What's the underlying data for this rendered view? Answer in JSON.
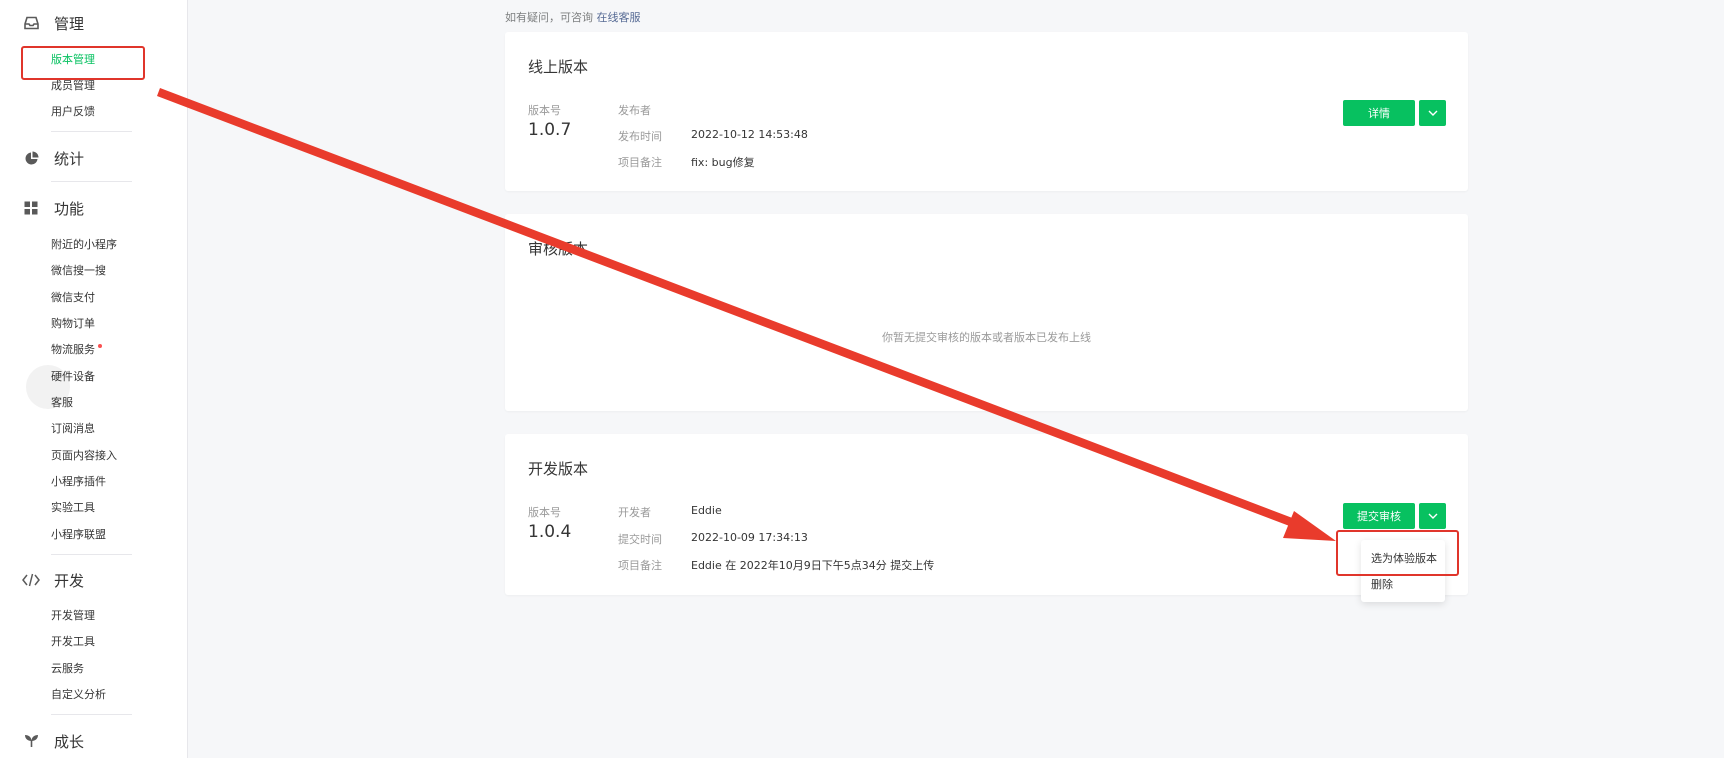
{
  "sidebar": {
    "groups": {
      "manage": {
        "label": "管理",
        "icon": "inbox-icon",
        "items": [
          "版本管理",
          "成员管理",
          "用户反馈"
        ]
      },
      "stats": {
        "label": "统计",
        "icon": "pie-chart-icon"
      },
      "features": {
        "label": "功能",
        "icon": "grid-icon",
        "items": [
          "附近的小程序",
          "微信搜一搜",
          "微信支付",
          "购物订单",
          "物流服务",
          "硬件设备",
          "客服",
          "订阅消息",
          "页面内容接入",
          "小程序插件",
          "实验工具",
          "小程序联盟"
        ]
      },
      "develop": {
        "label": "开发",
        "icon": "code-icon",
        "items": [
          "开发管理",
          "开发工具",
          "云服务",
          "自定义分析"
        ]
      },
      "growth": {
        "label": "成长",
        "icon": "sprout-icon"
      }
    }
  },
  "helper": {
    "text": "如有疑问，可咨询",
    "link": "在线客服"
  },
  "online_version": {
    "title": "线上版本",
    "version_label": "版本号",
    "version": "1.0.7",
    "publisher_label": "发布者",
    "publisher": "",
    "time_label": "发布时间",
    "time": "2022-10-12 14:53:48",
    "note_label": "项目备注",
    "note": "fix: bug修复",
    "detail_button": "详情"
  },
  "review_version": {
    "title": "审核版本",
    "empty_text": "你暂无提交审核的版本或者版本已发布上线"
  },
  "dev_version": {
    "title": "开发版本",
    "version_label": "版本号",
    "version": "1.0.4",
    "developer_label": "开发者",
    "developer": "Eddie",
    "time_label": "提交时间",
    "time": "2022-10-09 17:34:13",
    "note_label": "项目备注",
    "note": "Eddie 在 2022年10月9日下午5点34分 提交上传",
    "submit_button": "提交审核",
    "dropdown": [
      "选为体验版本",
      "删除"
    ]
  },
  "colors": {
    "accent": "#07c160",
    "annotation": "#e0352b",
    "link": "#576b95"
  }
}
